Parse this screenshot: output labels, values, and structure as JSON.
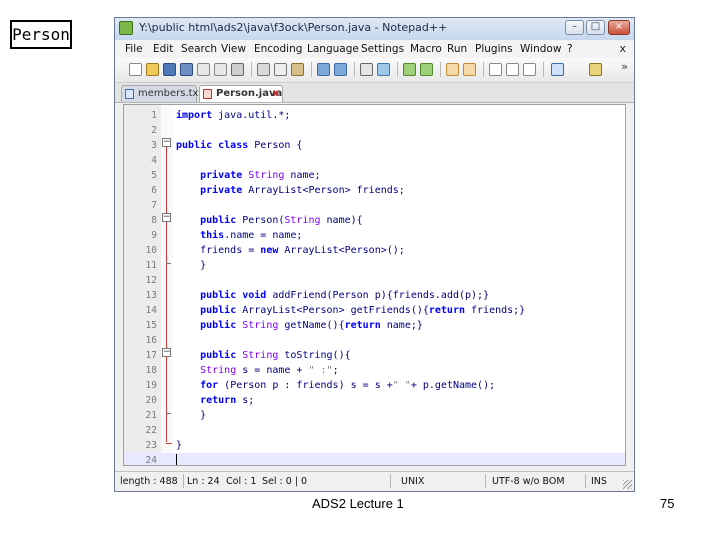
{
  "slide": {
    "label": "Person",
    "footer": "ADS2 Lecture 1",
    "page_number": "75"
  },
  "window": {
    "title": "Y:\\public html\\ads2\\java\\f3ock\\Person.java - Notepad++",
    "minimize": "–",
    "maximize": "□",
    "close": "×"
  },
  "menu": {
    "items": [
      "File",
      "Edit",
      "Search",
      "View",
      "Encoding",
      "Language",
      "Settings",
      "Macro",
      "Run",
      "Plugins",
      "Window",
      "?"
    ],
    "close": "x"
  },
  "toolbar": {
    "more": "»",
    "icons": [
      "new-file-icon",
      "open-file-icon",
      "save-icon",
      "save-all-icon",
      "close-icon",
      "close-all-icon",
      "print-icon",
      "cut-icon",
      "copy-icon",
      "paste-icon",
      "undo-icon",
      "redo-icon",
      "find-icon",
      "replace-icon",
      "zoom-in-icon",
      "zoom-out-icon",
      "sync-v-icon",
      "sync-h-icon",
      "word-wrap-icon",
      "show-all-chars-icon",
      "indent-guide-icon",
      "macro-record-icon",
      "macro-play-icon"
    ]
  },
  "tabs": [
    {
      "label": "members.txt",
      "active": false
    },
    {
      "label": "Person.java",
      "active": true,
      "close": "x"
    }
  ],
  "editor": {
    "current_line": 24,
    "lines": [
      {
        "num": "1",
        "html": "<b>import</b> java.util.*;"
      },
      {
        "num": "2",
        "html": ""
      },
      {
        "num": "3",
        "html": "<b>public class</b> Person {"
      },
      {
        "num": "4",
        "html": ""
      },
      {
        "num": "5",
        "html": "    <b>private</b> <span class=\"t\">String</span> name;"
      },
      {
        "num": "6",
        "html": "    <b>private</b> ArrayList&lt;Person&gt; friends;"
      },
      {
        "num": "7",
        "html": ""
      },
      {
        "num": "8",
        "html": "    <b>public</b> Person(<span class=\"t\">String</span> name){"
      },
      {
        "num": "9",
        "html": "    <b>this</b>.name = name;"
      },
      {
        "num": "10",
        "html": "    friends = <b>new</b> ArrayList&lt;Person&gt;();"
      },
      {
        "num": "11",
        "html": "    }"
      },
      {
        "num": "12",
        "html": ""
      },
      {
        "num": "13",
        "html": "    <b>public void</b> addFriend(Person p){friends.add(p);}"
      },
      {
        "num": "14",
        "html": "    <b>public</b> ArrayList&lt;Person&gt; getFriends(){<b>return</b> friends;}"
      },
      {
        "num": "15",
        "html": "    <b>public</b> <span class=\"t\">String</span> getName(){<b>return</b> name;}"
      },
      {
        "num": "16",
        "html": ""
      },
      {
        "num": "17",
        "html": "    <b>public</b> <span class=\"t\">String</span> toString(){"
      },
      {
        "num": "18",
        "html": "    <span class=\"t\">String</span> s = name + <span class=\"s\">\" :\"</span>;"
      },
      {
        "num": "19",
        "html": "    <b>for</b> (Person p : friends) s = s +<span class=\"s\">\" \"</span>+ p.getName();"
      },
      {
        "num": "20",
        "html": "    <b>return</b> s;"
      },
      {
        "num": "21",
        "html": "    }"
      },
      {
        "num": "22",
        "html": ""
      },
      {
        "num": "23",
        "html": "}"
      },
      {
        "num": "24",
        "html": ""
      }
    ]
  },
  "status": {
    "length": "length : 488",
    "ln": "Ln : 24",
    "col": "Col : 1",
    "sel": "Sel : 0 | 0",
    "eol": "UNIX",
    "encoding": "UTF-8 w/o BOM",
    "mode": "INS"
  }
}
